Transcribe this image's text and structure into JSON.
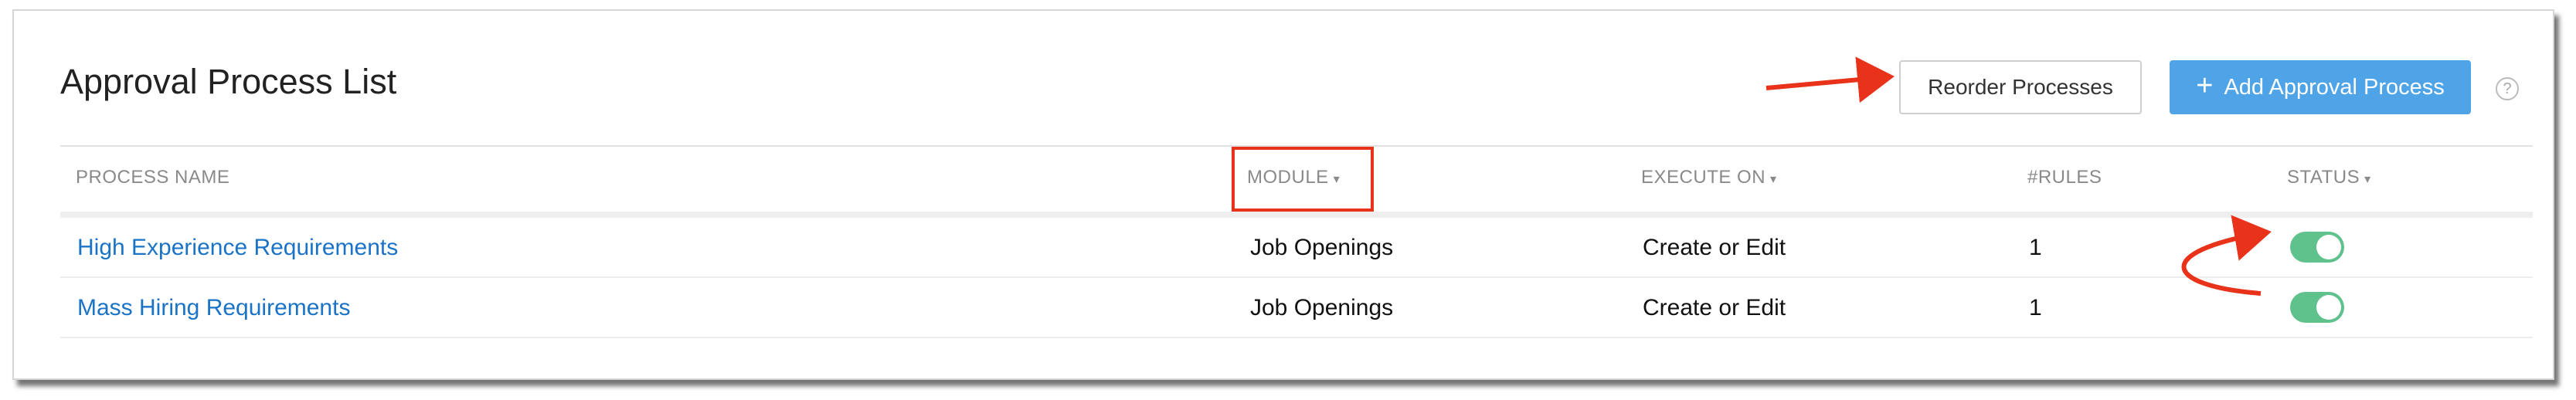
{
  "header": {
    "title": "Approval Process List",
    "reorder_label": "Reorder Processes",
    "add_label": "Add Approval Process",
    "add_icon": "plus-icon",
    "help_glyph": "?"
  },
  "table": {
    "columns": {
      "process_name": "PROCESS NAME",
      "module": "MODULE",
      "execute_on": "EXECUTE ON",
      "rules": "#RULES",
      "status": "STATUS"
    },
    "rows": [
      {
        "name": "High Experience Requirements",
        "module": "Job Openings",
        "execute_on": "Create or Edit",
        "rules": "1",
        "status": "on"
      },
      {
        "name": "Mass Hiring Requirements",
        "module": "Job Openings",
        "execute_on": "Create or Edit",
        "rules": "1",
        "status": "on"
      }
    ]
  },
  "colors": {
    "accent": "#4fa4e8",
    "link": "#1a73c7",
    "toggle_on": "#5fc28c",
    "annotation": "#e8321a"
  }
}
